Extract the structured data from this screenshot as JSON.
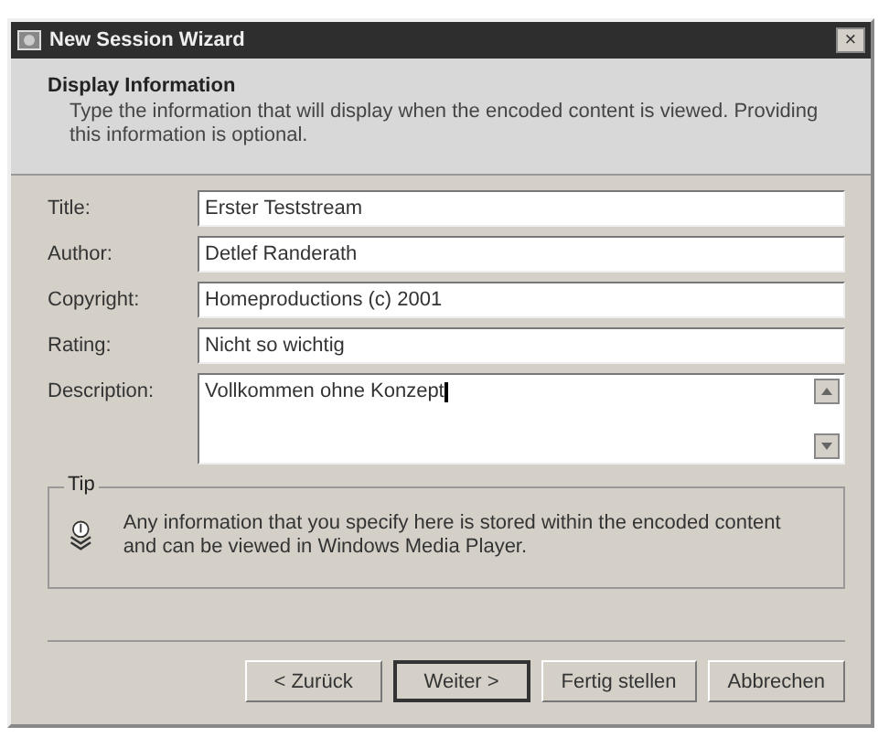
{
  "window": {
    "title": "New Session Wizard",
    "close": "×"
  },
  "header": {
    "title": "Display Information",
    "description": "Type the information that will display when the encoded content is viewed. Providing this information is optional."
  },
  "fields": [
    {
      "label": "Title:",
      "value": "Erster Teststream",
      "kind": "line"
    },
    {
      "label": "Author:",
      "value": "Detlef Randerath",
      "kind": "line"
    },
    {
      "label": "Copyright:",
      "value": "Homeproductions (c) 2001",
      "kind": "line"
    },
    {
      "label": "Rating:",
      "value": "Nicht so wichtig",
      "kind": "line"
    },
    {
      "label": "Description:",
      "value": "Vollkommen ohne Konzept",
      "kind": "multiline"
    }
  ],
  "tip": {
    "legend": "Tip",
    "text": "Any information that you specify here is stored within the encoded content and can be viewed in Windows Media Player."
  },
  "buttons": [
    {
      "label": "< Zurück",
      "default": false
    },
    {
      "label": "Weiter >",
      "default": true
    },
    {
      "label": "Fertig stellen",
      "default": false
    },
    {
      "label": "Abbrechen",
      "default": false
    }
  ]
}
